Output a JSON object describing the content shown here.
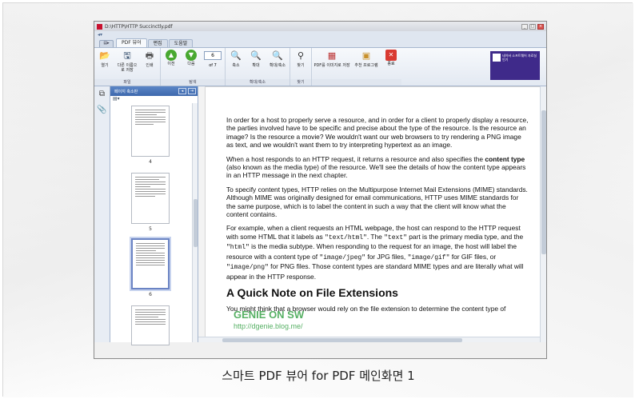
{
  "caption": "스마트 PDF 뷰어 for PDF 메인화면 1",
  "window": {
    "title": "D:\\HTTP\\HTTP Succinctly.pdf"
  },
  "tabs": {
    "menu": "메뉴",
    "items": [
      "PDF 뷰어",
      "편집",
      "도움말"
    ]
  },
  "ribbon": {
    "file_group": {
      "label": "파일",
      "buttons": [
        "열기",
        "다른 이름으로 저장",
        "인쇄"
      ]
    },
    "nav_group": {
      "label": "탐색",
      "prev": "이전",
      "next": "다음",
      "page_value": "6",
      "page_of": "of 7"
    },
    "zoom_group": {
      "label": "확대/축소",
      "buttons": [
        "축소",
        "확대",
        "확대/축소"
      ]
    },
    "find_group": {
      "label": "찾기",
      "buttons": [
        "찾기"
      ]
    },
    "tools_group": {
      "buttons": [
        "PDF를 이미지로 저장",
        "추천 프로그램",
        "종료"
      ]
    },
    "ad_text": "네이버 소프트웨어 자료실 인기"
  },
  "thumb_panel": {
    "title": "페이지 축소판",
    "pages": [
      "4",
      "5",
      "6"
    ]
  },
  "document": {
    "p1": "In order for a host to properly serve a resource, and in order for a client to properly display a resource, the parties involved have to be specific and precise about the type of the resource. Is the resource an image? Is the resource a movie? We wouldn't want our web browsers to try rendering a PNG image as text, and we wouldn't want them to try interpreting hypertext as an image.",
    "p2_a": "When a host responds to an HTTP request, it returns a resource and also specifies the ",
    "p2_b": "content type",
    "p2_c": " (also known as the media type) of the resource. We'll see the details of how the content type appears in an HTTP message in the next chapter.",
    "p3": "To specify content types, HTTP relies on the Multipurpose Internet Mail Extensions (MIME) standards. Although MIME was originally designed for email communications, HTTP uses MIME standards for the same purpose, which is to label the content in such a way that the client will know what the content contains.",
    "p4_a": "For example, when a client requests an HTML webpage, the host can respond to the HTTP request with some HTML that it labels as ",
    "p4_code1": "\"text/html\"",
    "p4_b": ". The ",
    "p4_code2": "\"text\"",
    "p4_c": " part is the primary media type, and the ",
    "p4_code3": "\"html\"",
    "p4_d": " is the media subtype. When responding to the request for an image, the host will label the resource with a content type of ",
    "p4_code4": "\"image/jpeg\"",
    "p4_e": " for JPG files, ",
    "p4_code5": "\"image/gif\"",
    "p4_f": " for GIF files, or ",
    "p4_code6": "\"image/png\"",
    "p4_g": " for PNG files. Those content types are standard MIME types and are literally what will appear in the HTTP response.",
    "heading": "A Quick Note on File Extensions",
    "p5": "You might think that a browser would rely on the file extension to determine the content type of"
  },
  "watermark": {
    "line1": "GENIE ON SW",
    "line2": "http://dgenie.blog.me/"
  }
}
